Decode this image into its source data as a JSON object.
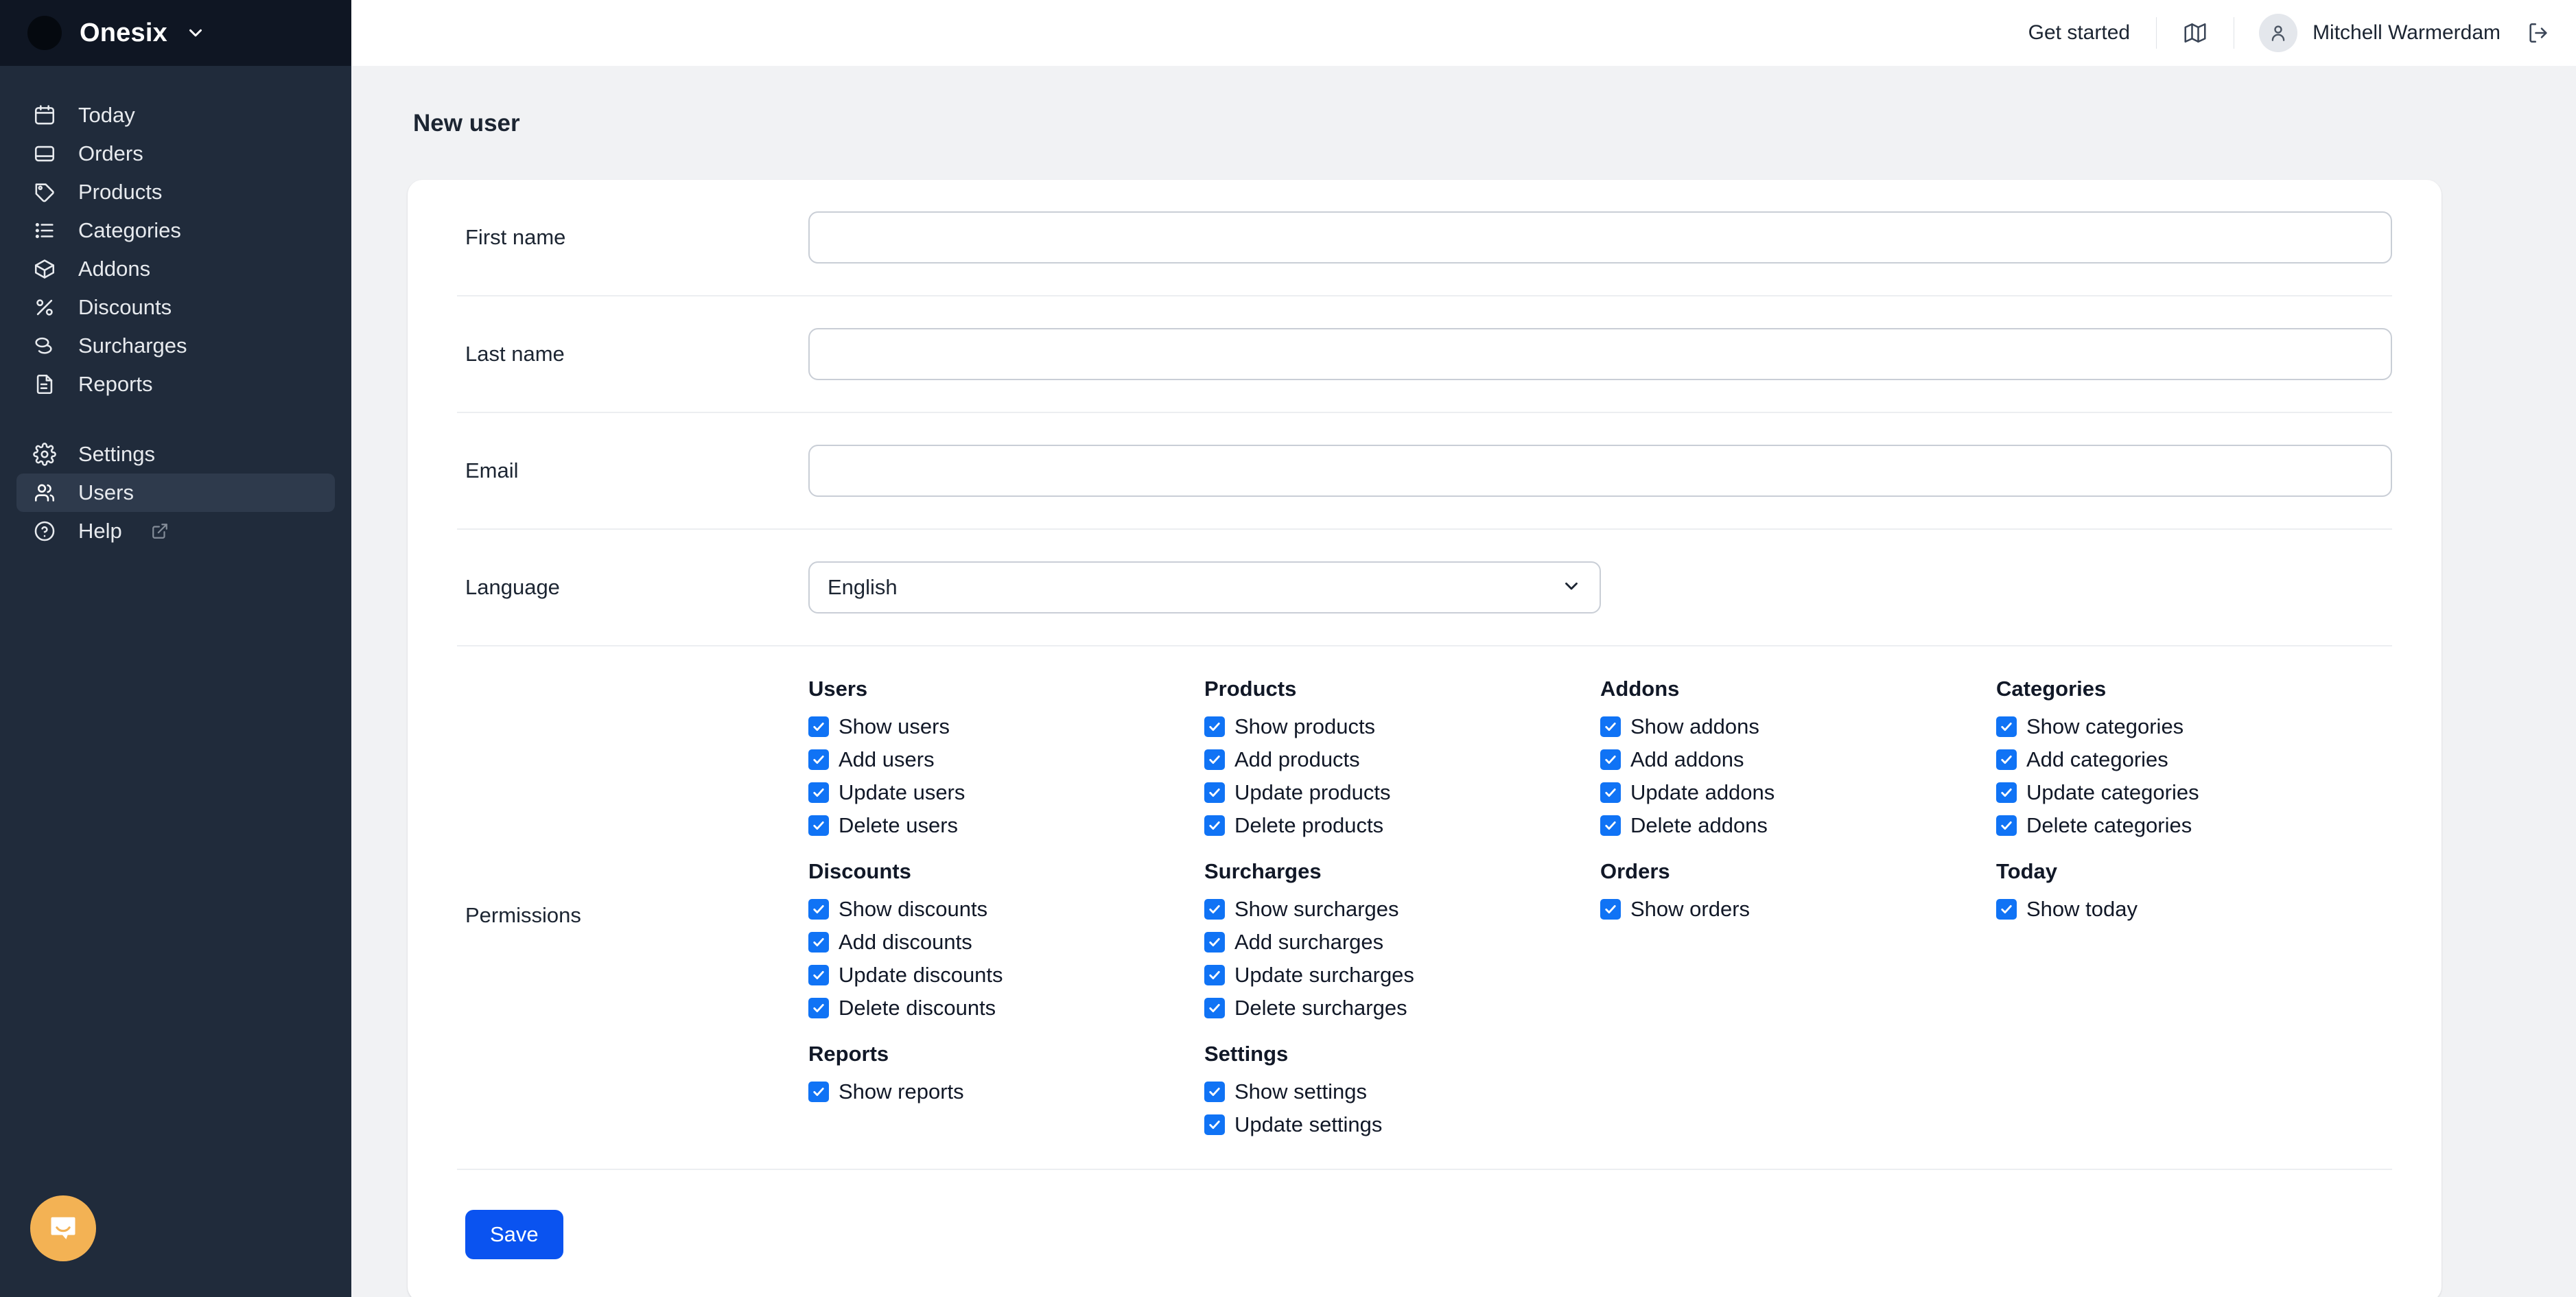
{
  "sidebar": {
    "brand": {
      "name": "Onesix",
      "logo_icon": "circle-logo",
      "chevron_icon": "chevron-down-icon"
    },
    "items": [
      {
        "label": "Today",
        "icon": "calendar-icon",
        "active": false
      },
      {
        "label": "Orders",
        "icon": "inbox-icon",
        "active": false
      },
      {
        "label": "Products",
        "icon": "tag-icon",
        "active": false
      },
      {
        "label": "Categories",
        "icon": "list-icon",
        "active": false
      },
      {
        "label": "Addons",
        "icon": "box-icon",
        "active": false
      },
      {
        "label": "Discounts",
        "icon": "percent-icon",
        "active": false
      },
      {
        "label": "Surcharges",
        "icon": "coins-icon",
        "active": false
      },
      {
        "label": "Reports",
        "icon": "document-icon",
        "active": false
      }
    ],
    "items_bottom": [
      {
        "label": "Settings",
        "icon": "gear-icon",
        "active": false,
        "external": false
      },
      {
        "label": "Users",
        "icon": "users-icon",
        "active": true,
        "external": false
      },
      {
        "label": "Help",
        "icon": "question-circle-icon",
        "active": false,
        "external": true
      }
    ],
    "chat_widget": {
      "icon": "intercom-chat-icon",
      "color": "#f3b254"
    }
  },
  "topbar": {
    "get_started": "Get started",
    "map_icon": "map-icon",
    "user_icon": "person-icon",
    "username": "Mitchell Warmerdam",
    "logout_icon": "logout-icon"
  },
  "page": {
    "title": "New user"
  },
  "form": {
    "first_name": {
      "label": "First name",
      "value": "",
      "placeholder": ""
    },
    "last_name": {
      "label": "Last name",
      "value": "",
      "placeholder": ""
    },
    "email": {
      "label": "Email",
      "value": "",
      "placeholder": ""
    },
    "language": {
      "label": "Language",
      "value": "English",
      "chevron_icon": "chevron-down-icon"
    },
    "permissions_label": "Permissions",
    "save_label": "Save",
    "save_color": "#0a53f0",
    "checkbox_color": "#1073f5"
  },
  "permissions": [
    {
      "group": "Users",
      "items": [
        {
          "label": "Show users",
          "checked": true
        },
        {
          "label": "Add users",
          "checked": true
        },
        {
          "label": "Update users",
          "checked": true
        },
        {
          "label": "Delete users",
          "checked": true
        }
      ]
    },
    {
      "group": "Products",
      "items": [
        {
          "label": "Show products",
          "checked": true
        },
        {
          "label": "Add products",
          "checked": true
        },
        {
          "label": "Update products",
          "checked": true
        },
        {
          "label": "Delete products",
          "checked": true
        }
      ]
    },
    {
      "group": "Addons",
      "items": [
        {
          "label": "Show addons",
          "checked": true
        },
        {
          "label": "Add addons",
          "checked": true
        },
        {
          "label": "Update addons",
          "checked": true
        },
        {
          "label": "Delete addons",
          "checked": true
        }
      ]
    },
    {
      "group": "Categories",
      "items": [
        {
          "label": "Show categories",
          "checked": true
        },
        {
          "label": "Add categories",
          "checked": true
        },
        {
          "label": "Update categories",
          "checked": true
        },
        {
          "label": "Delete categories",
          "checked": true
        }
      ]
    },
    {
      "group": "Discounts",
      "items": [
        {
          "label": "Show discounts",
          "checked": true
        },
        {
          "label": "Add discounts",
          "checked": true
        },
        {
          "label": "Update discounts",
          "checked": true
        },
        {
          "label": "Delete discounts",
          "checked": true
        }
      ]
    },
    {
      "group": "Surcharges",
      "items": [
        {
          "label": "Show surcharges",
          "checked": true
        },
        {
          "label": "Add surcharges",
          "checked": true
        },
        {
          "label": "Update surcharges",
          "checked": true
        },
        {
          "label": "Delete surcharges",
          "checked": true
        }
      ]
    },
    {
      "group": "Orders",
      "items": [
        {
          "label": "Show orders",
          "checked": true
        }
      ]
    },
    {
      "group": "Today",
      "items": [
        {
          "label": "Show today",
          "checked": true
        }
      ]
    },
    {
      "group": "Reports",
      "items": [
        {
          "label": "Show reports",
          "checked": true
        }
      ]
    },
    {
      "group": "Settings",
      "items": [
        {
          "label": "Show settings",
          "checked": true
        },
        {
          "label": "Update settings",
          "checked": true
        }
      ]
    }
  ]
}
